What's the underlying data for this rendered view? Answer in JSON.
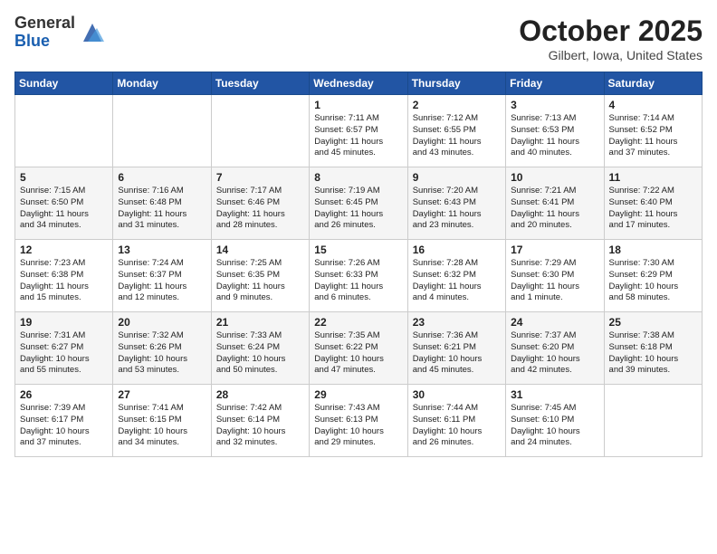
{
  "logo": {
    "general": "General",
    "blue": "Blue"
  },
  "header": {
    "month": "October 2025",
    "location": "Gilbert, Iowa, United States"
  },
  "weekdays": [
    "Sunday",
    "Monday",
    "Tuesday",
    "Wednesday",
    "Thursday",
    "Friday",
    "Saturday"
  ],
  "weeks": [
    [
      {
        "day": "",
        "info": ""
      },
      {
        "day": "",
        "info": ""
      },
      {
        "day": "",
        "info": ""
      },
      {
        "day": "1",
        "info": "Sunrise: 7:11 AM\nSunset: 6:57 PM\nDaylight: 11 hours\nand 45 minutes."
      },
      {
        "day": "2",
        "info": "Sunrise: 7:12 AM\nSunset: 6:55 PM\nDaylight: 11 hours\nand 43 minutes."
      },
      {
        "day": "3",
        "info": "Sunrise: 7:13 AM\nSunset: 6:53 PM\nDaylight: 11 hours\nand 40 minutes."
      },
      {
        "day": "4",
        "info": "Sunrise: 7:14 AM\nSunset: 6:52 PM\nDaylight: 11 hours\nand 37 minutes."
      }
    ],
    [
      {
        "day": "5",
        "info": "Sunrise: 7:15 AM\nSunset: 6:50 PM\nDaylight: 11 hours\nand 34 minutes."
      },
      {
        "day": "6",
        "info": "Sunrise: 7:16 AM\nSunset: 6:48 PM\nDaylight: 11 hours\nand 31 minutes."
      },
      {
        "day": "7",
        "info": "Sunrise: 7:17 AM\nSunset: 6:46 PM\nDaylight: 11 hours\nand 28 minutes."
      },
      {
        "day": "8",
        "info": "Sunrise: 7:19 AM\nSunset: 6:45 PM\nDaylight: 11 hours\nand 26 minutes."
      },
      {
        "day": "9",
        "info": "Sunrise: 7:20 AM\nSunset: 6:43 PM\nDaylight: 11 hours\nand 23 minutes."
      },
      {
        "day": "10",
        "info": "Sunrise: 7:21 AM\nSunset: 6:41 PM\nDaylight: 11 hours\nand 20 minutes."
      },
      {
        "day": "11",
        "info": "Sunrise: 7:22 AM\nSunset: 6:40 PM\nDaylight: 11 hours\nand 17 minutes."
      }
    ],
    [
      {
        "day": "12",
        "info": "Sunrise: 7:23 AM\nSunset: 6:38 PM\nDaylight: 11 hours\nand 15 minutes."
      },
      {
        "day": "13",
        "info": "Sunrise: 7:24 AM\nSunset: 6:37 PM\nDaylight: 11 hours\nand 12 minutes."
      },
      {
        "day": "14",
        "info": "Sunrise: 7:25 AM\nSunset: 6:35 PM\nDaylight: 11 hours\nand 9 minutes."
      },
      {
        "day": "15",
        "info": "Sunrise: 7:26 AM\nSunset: 6:33 PM\nDaylight: 11 hours\nand 6 minutes."
      },
      {
        "day": "16",
        "info": "Sunrise: 7:28 AM\nSunset: 6:32 PM\nDaylight: 11 hours\nand 4 minutes."
      },
      {
        "day": "17",
        "info": "Sunrise: 7:29 AM\nSunset: 6:30 PM\nDaylight: 11 hours\nand 1 minute."
      },
      {
        "day": "18",
        "info": "Sunrise: 7:30 AM\nSunset: 6:29 PM\nDaylight: 10 hours\nand 58 minutes."
      }
    ],
    [
      {
        "day": "19",
        "info": "Sunrise: 7:31 AM\nSunset: 6:27 PM\nDaylight: 10 hours\nand 55 minutes."
      },
      {
        "day": "20",
        "info": "Sunrise: 7:32 AM\nSunset: 6:26 PM\nDaylight: 10 hours\nand 53 minutes."
      },
      {
        "day": "21",
        "info": "Sunrise: 7:33 AM\nSunset: 6:24 PM\nDaylight: 10 hours\nand 50 minutes."
      },
      {
        "day": "22",
        "info": "Sunrise: 7:35 AM\nSunset: 6:22 PM\nDaylight: 10 hours\nand 47 minutes."
      },
      {
        "day": "23",
        "info": "Sunrise: 7:36 AM\nSunset: 6:21 PM\nDaylight: 10 hours\nand 45 minutes."
      },
      {
        "day": "24",
        "info": "Sunrise: 7:37 AM\nSunset: 6:20 PM\nDaylight: 10 hours\nand 42 minutes."
      },
      {
        "day": "25",
        "info": "Sunrise: 7:38 AM\nSunset: 6:18 PM\nDaylight: 10 hours\nand 39 minutes."
      }
    ],
    [
      {
        "day": "26",
        "info": "Sunrise: 7:39 AM\nSunset: 6:17 PM\nDaylight: 10 hours\nand 37 minutes."
      },
      {
        "day": "27",
        "info": "Sunrise: 7:41 AM\nSunset: 6:15 PM\nDaylight: 10 hours\nand 34 minutes."
      },
      {
        "day": "28",
        "info": "Sunrise: 7:42 AM\nSunset: 6:14 PM\nDaylight: 10 hours\nand 32 minutes."
      },
      {
        "day": "29",
        "info": "Sunrise: 7:43 AM\nSunset: 6:13 PM\nDaylight: 10 hours\nand 29 minutes."
      },
      {
        "day": "30",
        "info": "Sunrise: 7:44 AM\nSunset: 6:11 PM\nDaylight: 10 hours\nand 26 minutes."
      },
      {
        "day": "31",
        "info": "Sunrise: 7:45 AM\nSunset: 6:10 PM\nDaylight: 10 hours\nand 24 minutes."
      },
      {
        "day": "",
        "info": ""
      }
    ]
  ]
}
